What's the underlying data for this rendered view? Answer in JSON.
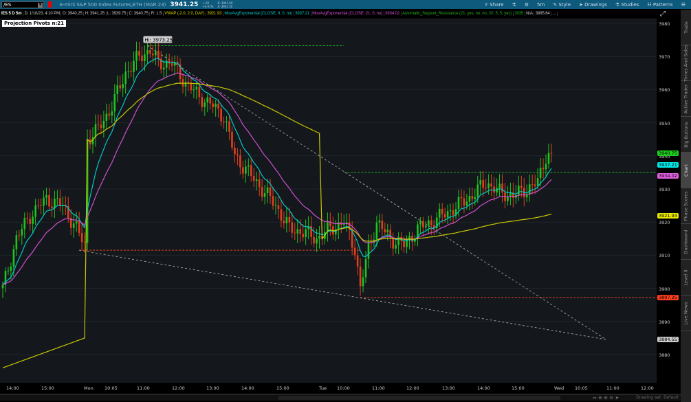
{
  "header": {
    "symbol": "/ES",
    "description": "E-mini S&P 500 Index Futures,ETH (MAR 23)",
    "last": "3941.25",
    "change": "+.50",
    "change_pct": "+0.01%",
    "bid": "B: 3941.00",
    "ask": "A: 3941.50",
    "tools": [
      "Share",
      "Style",
      "Drawings",
      "Studies",
      "Patterns"
    ],
    "timeframe": "5m"
  },
  "info": [
    "/ES 5 D 5m",
    "D: 1/10/23, 4:10 PM",
    "O: 3940.25",
    "H: 3941.25",
    "L: 3939.75",
    "C: 3940.75",
    "R: 1.5"
  ],
  "studies": [
    {
      "label": "VWAP (-2.0, 2.0, DAY)",
      "value": "3921.93",
      "color": "#d4d400"
    },
    {
      "label": "MovAvgExponential (CLOSE, 9, 0, no)",
      "value": "3937.21",
      "color": "#00c8c8"
    },
    {
      "label": "MovAvgExponential (CLOSE, 21, 0, no)",
      "value": "3934.02",
      "color": "#d050d0"
    },
    {
      "label": "Automatic_Support_Resistance (21, yes, no, no, 20, 5, 5, yes)",
      "value": "3935",
      "color": "#20b020"
    }
  ],
  "extra_values": [
    "N/A",
    "3895.64",
    "..."
  ],
  "projection_label": "Projection Pivots n:21",
  "hi_label": "Hi: 3973.25",
  "price_ticks": [
    "3980",
    "3970",
    "3960",
    "3950",
    "3940",
    "3930",
    "3920",
    "3910",
    "3900",
    "3890",
    "3880"
  ],
  "price_labels": [
    {
      "text": "3940.75",
      "price": 3940.75,
      "color": "#20d020"
    },
    {
      "text": "3937.21",
      "price": 3937.21,
      "color": "#00e8e8"
    },
    {
      "text": "3934.02",
      "price": 3934.02,
      "color": "#e060e0"
    },
    {
      "text": "3921.93",
      "price": 3921.93,
      "color": "#e8e800"
    },
    {
      "text": "3897.25",
      "price": 3897.25,
      "color": "#ff4020"
    },
    {
      "text": "3884.55",
      "price": 3884.55,
      "color": "#ccc"
    }
  ],
  "time_ticks": [
    "14:00",
    "15:00",
    "Mon",
    "10:05",
    "11:00",
    "12:00",
    "13:00",
    "14:00",
    "15:00",
    "Tue",
    "10:00",
    "11:00",
    "12:00",
    "13:00",
    "14:00",
    "15:00",
    "Wed",
    "10:05",
    "11:00",
    "12:00"
  ],
  "side_tabs": [
    "Trade",
    "Times And Sales",
    "Active Trader",
    "Big Buttons",
    "Chart",
    "Phase Scores",
    "Dashboard",
    "Level II",
    "Live News"
  ],
  "drawing_set": "Drawing set: Default",
  "chart_data": {
    "type": "candlestick",
    "ylim": [
      3875,
      3985
    ],
    "close_path": [
      [
        0,
        3900
      ],
      [
        5,
        3915
      ],
      [
        10,
        3922
      ],
      [
        16,
        3927
      ],
      [
        22,
        3925
      ],
      [
        27,
        3918
      ],
      [
        30,
        3913
      ],
      [
        31,
        3945
      ],
      [
        35,
        3948
      ],
      [
        40,
        3955
      ],
      [
        45,
        3965
      ],
      [
        50,
        3970
      ],
      [
        54,
        3972
      ],
      [
        57,
        3968
      ],
      [
        62,
        3968
      ],
      [
        67,
        3962
      ],
      [
        72,
        3958
      ],
      [
        77,
        3955
      ],
      [
        81,
        3952
      ],
      [
        85,
        3940
      ],
      [
        90,
        3935
      ],
      [
        95,
        3930
      ],
      [
        100,
        3925
      ],
      [
        105,
        3918
      ],
      [
        110,
        3917
      ],
      [
        115,
        3915
      ],
      [
        120,
        3918
      ],
      [
        125,
        3920
      ],
      [
        129,
        3912
      ],
      [
        131,
        3900
      ],
      [
        134,
        3912
      ],
      [
        137,
        3920
      ],
      [
        142,
        3915
      ],
      [
        147,
        3913
      ],
      [
        152,
        3918
      ],
      [
        157,
        3920
      ],
      [
        165,
        3924
      ],
      [
        172,
        3928
      ],
      [
        177,
        3932
      ],
      [
        182,
        3929
      ],
      [
        187,
        3928
      ],
      [
        192,
        3930
      ],
      [
        196,
        3932
      ],
      [
        199,
        3940
      ],
      [
        201,
        3941
      ]
    ],
    "session_starts": [
      0,
      31,
      117
    ],
    "levels": [
      {
        "price": 3973.25,
        "from": 53,
        "to": 125,
        "color": "#20b020"
      },
      {
        "price": 3935,
        "from": 125,
        "to": 238,
        "color": "#20b020"
      },
      {
        "price": 3911.5,
        "from": 28,
        "to": 131,
        "color": "#e04020"
      },
      {
        "price": 3897.25,
        "from": 131,
        "to": 238,
        "color": "#e04020"
      }
    ],
    "trendlines": [
      [
        [
          53,
          3973.25
        ],
        [
          221,
          3884.55
        ]
      ],
      [
        [
          28,
          3911.5
        ],
        [
          221,
          3884.55
        ]
      ]
    ]
  }
}
